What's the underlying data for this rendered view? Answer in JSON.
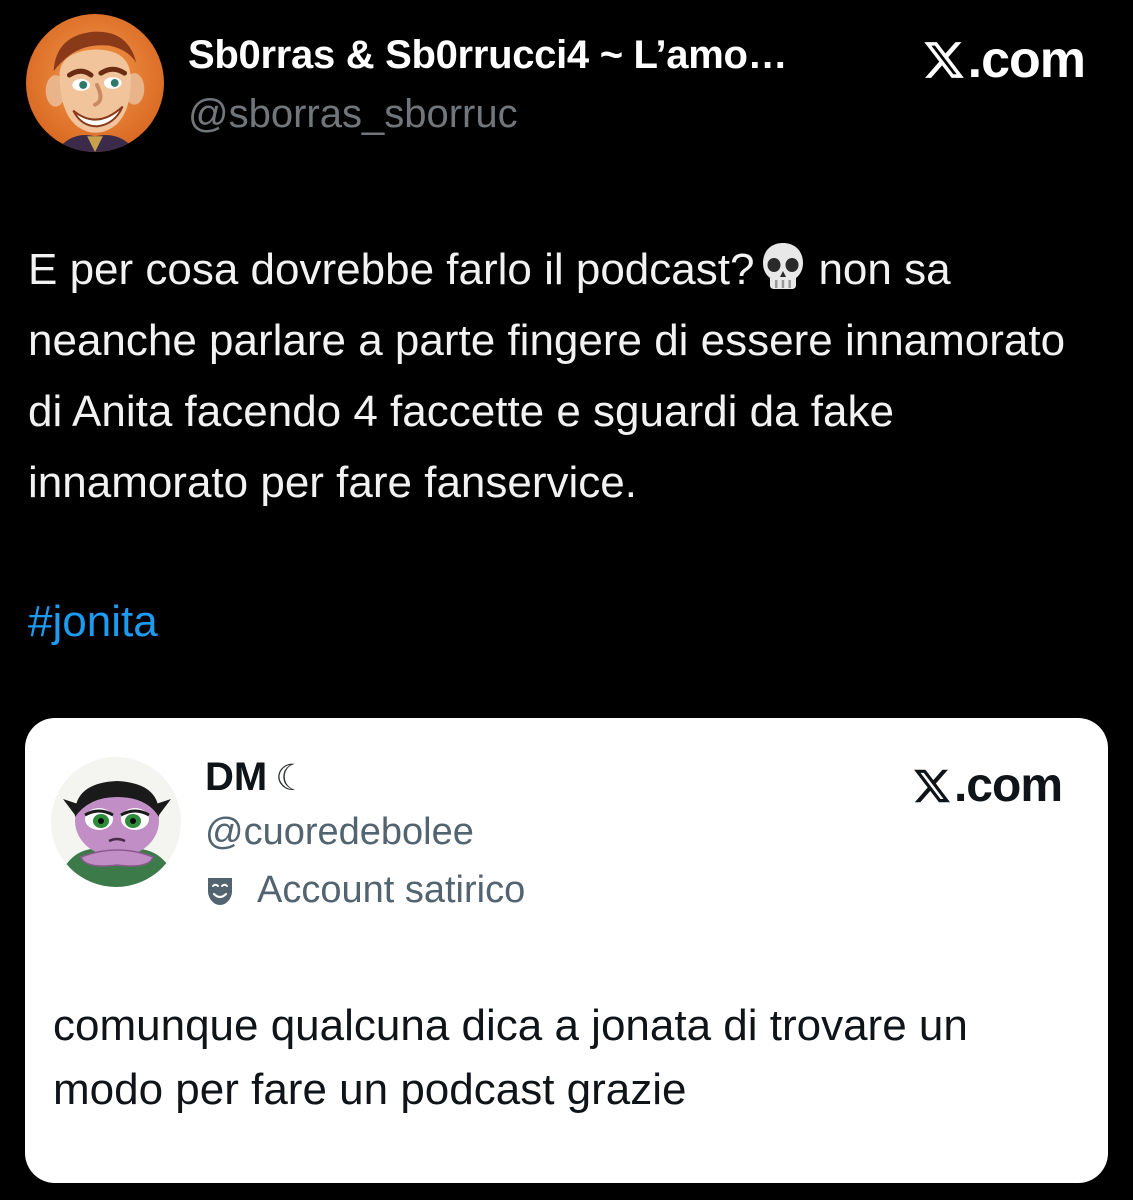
{
  "tweet": {
    "author": {
      "display_name": "Sb0rras & Sb0rrucci4 ~ L’amo…",
      "handle": "@sborras_sborruc",
      "avatar": "cartoon-character-avatar"
    },
    "brand": {
      "icon": "x-logo-icon",
      "label": ".com"
    },
    "text_part1": "E per cosa dovrebbe farlo il podcast?",
    "emoji": "skull-emoji",
    "text_part2": "non sa neanche parlare a parte fingere di essere innamorato di Anita facendo 4 faccette e sguardi da fake innamorato per fare fanservice.",
    "hashtag": "#jonita"
  },
  "quoted_tweet": {
    "author": {
      "display_name": "DM",
      "moon": "☾",
      "handle": "@cuoredebolee",
      "badge_icon": "theater-mask-icon",
      "badge_label": "Account satirico",
      "avatar": "cartoon-girl-avatar"
    },
    "brand": {
      "icon": "x-logo-icon",
      "label": ".com"
    },
    "text": "comunque qualcuna dica a jonata di trovare un modo per fare un podcast grazie"
  },
  "colors": {
    "background": "#000000",
    "card_background": "#ffffff",
    "hashtag": "#1d9bf0",
    "secondary_text": "#71767b",
    "card_secondary_text": "#536471"
  }
}
